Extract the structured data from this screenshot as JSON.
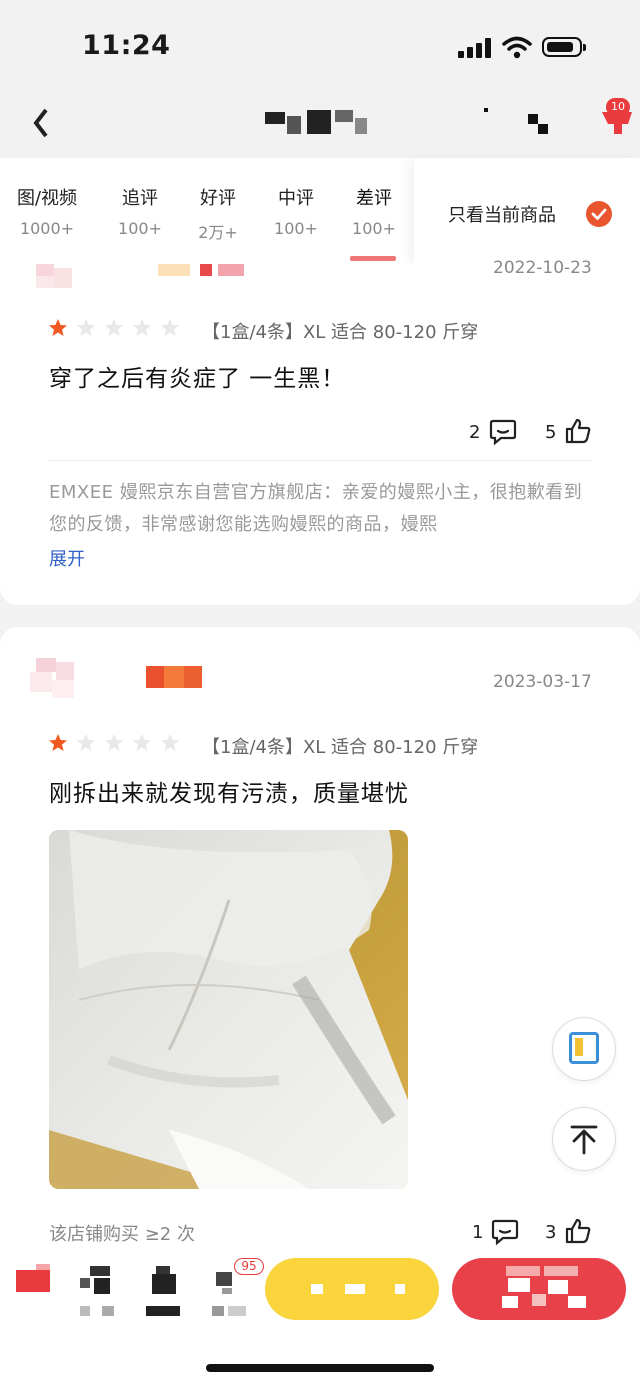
{
  "status_bar": {
    "time": "11:24"
  },
  "header": {
    "cart_badge": "10"
  },
  "tabs": [
    {
      "label": "图/视频",
      "count": "1000+"
    },
    {
      "label": "追评",
      "count": "100+"
    },
    {
      "label": "好评",
      "count": "2万+"
    },
    {
      "label": "中评",
      "count": "100+"
    },
    {
      "label": "差评",
      "count": "100+"
    }
  ],
  "active_tab": "差评",
  "only_current": {
    "label": "只看当前商品",
    "checked": true
  },
  "reviews": [
    {
      "date": "2022-10-23",
      "rating": 1,
      "spec": "【1盒/4条】XL 适合 80-120 斤穿",
      "text": "穿了之后有炎症了 一生黑！",
      "comments": "2",
      "likes": "5",
      "reply": "EMXEE 嫚熙京东自营官方旗舰店：亲爱的嫚熙小主，很抱歉看到您的反馈，非常感谢您能选购嫚熙的商品，嫚熙",
      "expand_label": "展开"
    },
    {
      "date": "2023-03-17",
      "rating": 1,
      "spec": "【1盒/4条】XL 适合 80-120 斤穿",
      "text": "刚拆出来就发现有污渍，质量堪忧",
      "comments": "1",
      "likes": "3",
      "footer_note": "该店铺购买 ≥2 次"
    }
  ],
  "floating": {
    "ask_icon": "问"
  },
  "bottom_bar": {
    "cart_badge": "95"
  },
  "colors": {
    "accent_red": "#e93b3d",
    "star_orange": "#f05a22",
    "yellow_button": "#f9d43d",
    "red_button": "#e8414a",
    "link_blue": "#3060c8"
  }
}
